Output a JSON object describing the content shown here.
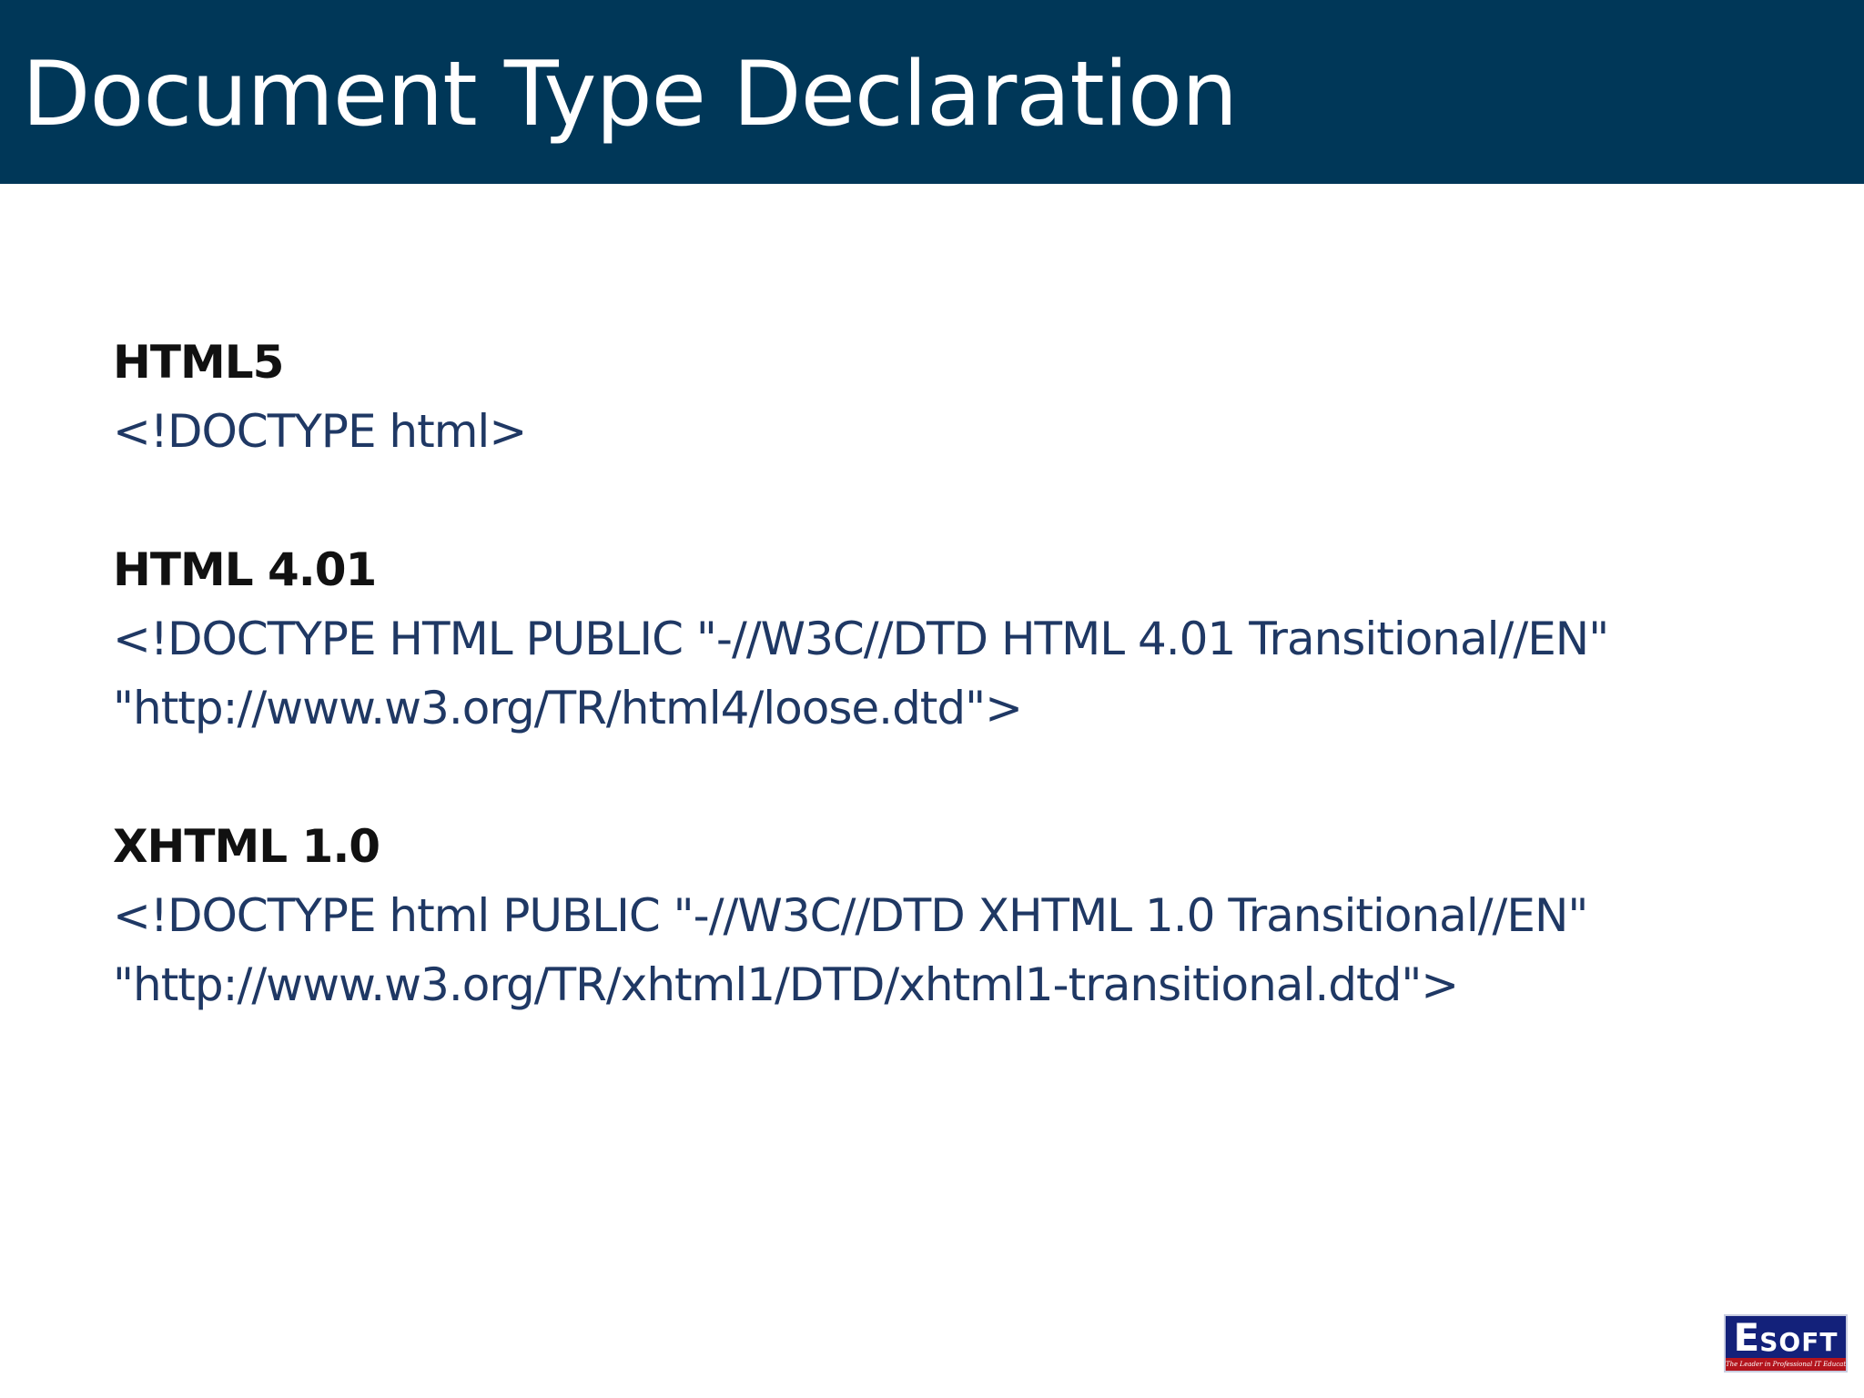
{
  "slide": {
    "title": "Document Type Declaration",
    "sections": [
      {
        "heading": "HTML5",
        "lines": [
          "<!DOCTYPE html>"
        ]
      },
      {
        "heading": "HTML 4.01",
        "lines": [
          "<!DOCTYPE HTML PUBLIC \"-//W3C//DTD HTML 4.01 Transitional//EN\"",
          "\"http://www.w3.org/TR/html4/loose.dtd\">"
        ]
      },
      {
        "heading": "XHTML 1.0",
        "lines": [
          "<!DOCTYPE html PUBLIC \"-//W3C//DTD XHTML 1.0 Transitional//EN\"",
          "\"http://www.w3.org/TR/xhtml1/DTD/xhtml1-transitional.dtd\">"
        ]
      }
    ]
  },
  "logo": {
    "letter_big": "E",
    "letters_rest": "SOFT",
    "tagline": "The Leader in Professional IT Education"
  },
  "colors": {
    "title_bar": "#003758",
    "title_text": "#ffffff",
    "heading_text": "#111111",
    "code_text": "#1f3864",
    "logo_blue": "#13217a",
    "logo_red": "#b3141d"
  }
}
